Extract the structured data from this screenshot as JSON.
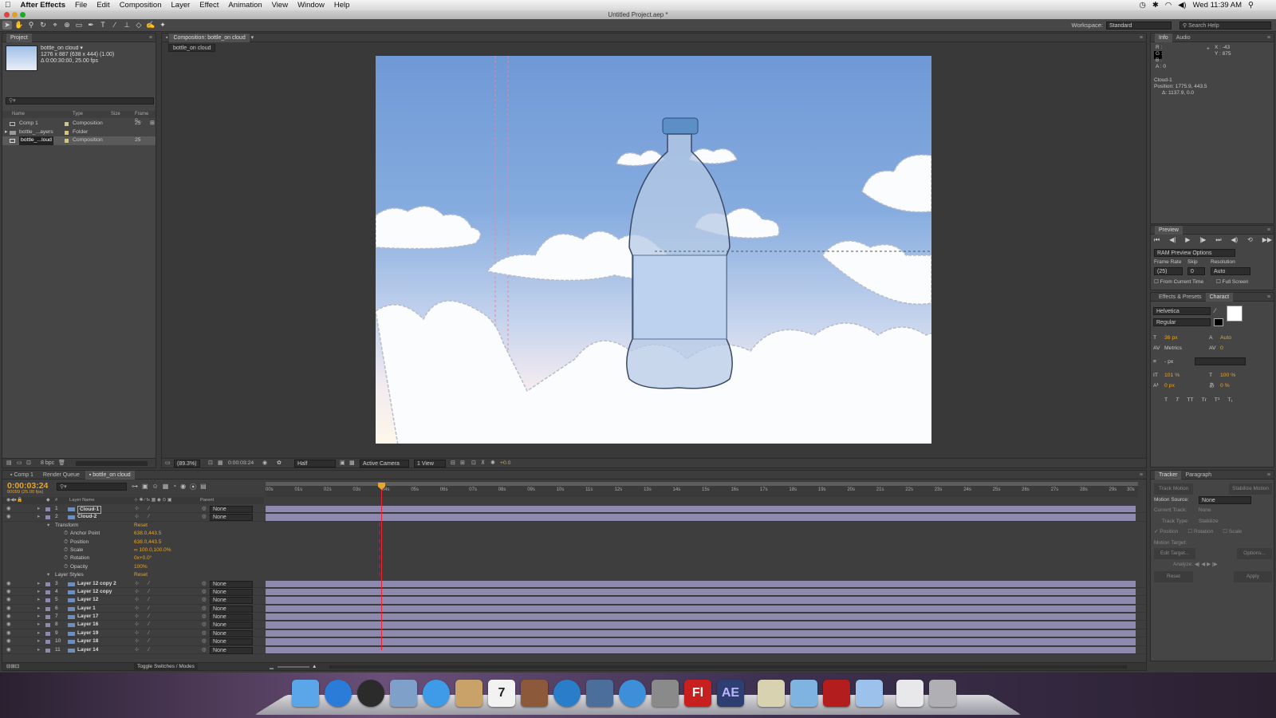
{
  "menubar": {
    "app": "After Effects",
    "items": [
      "File",
      "Edit",
      "Composition",
      "Layer",
      "Effect",
      "Animation",
      "View",
      "Window",
      "Help"
    ],
    "clock": "Wed 11:39 AM"
  },
  "window": {
    "title": "Untitled Project.aep *"
  },
  "toolbar": {
    "workspace_label": "Workspace:",
    "workspace_value": "Standard",
    "search_placeholder": "Search Help"
  },
  "project": {
    "tab": "Project",
    "item_name": "bottle_on cloud ▾",
    "item_dims": "1276 x 887  (638 x 444) (1.00)",
    "item_dur": "Δ 0:00:30:00, 25.00 fps",
    "cols": [
      "Name",
      "Type",
      "Size",
      "Frame R..."
    ],
    "rows": [
      {
        "name": "Comp 1",
        "type": "Composition",
        "fr": "25"
      },
      {
        "name": "bottle_...ayers",
        "type": "Folder",
        "fr": ""
      },
      {
        "name": "bottle_...loud",
        "type": "Composition",
        "fr": "25"
      }
    ],
    "bpc": "8 bpc"
  },
  "comp": {
    "tab": "Composition: bottle_on cloud",
    "subtab": "bottle_on cloud",
    "zoom": "(89.3%)",
    "time": "0:00:03:24",
    "res": "Half",
    "camera": "Active Camera",
    "views": "1 View",
    "exposure": "+0.0"
  },
  "info": {
    "tabs": [
      "Info",
      "Audio"
    ],
    "r": "R :",
    "g": "G :",
    "b": "B :",
    "a": "A : 0",
    "x": "X : -43",
    "y": "Y : 875",
    "layer": "Cloud-1",
    "position": "Position: 1775.9, 443.5",
    "delta": "Δ: 1137.9, 0.0"
  },
  "preview": {
    "tab": "Preview",
    "ram": "RAM Preview Options",
    "fr_label": "Frame Rate",
    "skip_label": "Skip",
    "res_label": "Resolution",
    "fr_val": "(25)",
    "skip_val": "0",
    "res_val": "Auto",
    "from_current": "From Current Time",
    "full_screen": "Full Screen"
  },
  "character": {
    "tabs": [
      "Effects & Presets",
      "Charact"
    ],
    "font": "Helvetica",
    "style": "Regular",
    "size": "36 px",
    "leading": "Auto",
    "kerning": "Metrics",
    "tracking": "0",
    "stroke": "- px",
    "vscale": "101 %",
    "hscale": "100 %",
    "baseline": "0 px",
    "tsume": "0 %",
    "buttons": [
      "T",
      "T",
      "TT",
      "Tr",
      "T¹",
      "T₁"
    ]
  },
  "tracker": {
    "tabs": [
      "Tracker",
      "Paragraph"
    ],
    "track_motion": "Track Motion",
    "stabilize": "Stabilize Motion",
    "motion_source": "Motion Source:",
    "motion_source_val": "None",
    "current_track": "Current Track:",
    "current_track_val": "None",
    "track_type": "Track Type:",
    "track_type_val": "Stabilize",
    "position": "Position",
    "rotation": "Rotation",
    "scale": "Scale",
    "motion_target": "Motion Target:",
    "edit_target": "Edit Target...",
    "options": "Options...",
    "analyze": "Analyze:",
    "reset": "Reset",
    "apply": "Apply"
  },
  "timeline": {
    "tabs": [
      "Comp 1",
      "Render Queue",
      "bottle_on cloud"
    ],
    "time": "0:00:03:24",
    "frames": "00099 (25.00 fps)",
    "col_layer": "Layer Name",
    "col_parent": "Parent",
    "toggle": "Toggle Switches / Modes",
    "ruler": [
      "00s",
      "01s",
      "02s",
      "03s",
      "04s",
      "05s",
      "06s",
      "07s",
      "08s",
      "09s",
      "10s",
      "11s",
      "12s",
      "13s",
      "14s",
      "15s",
      "16s",
      "17s",
      "18s",
      "19s",
      "20s",
      "21s",
      "22s",
      "23s",
      "24s",
      "25s",
      "26s",
      "27s",
      "28s",
      "29s",
      "30s"
    ],
    "layers_top": [
      {
        "num": "1",
        "name": "Cloud-1",
        "parent": "None"
      },
      {
        "num": "2",
        "name": "Cloud-2",
        "parent": "None"
      }
    ],
    "transform": {
      "label": "Transform",
      "reset": "Reset",
      "props": [
        {
          "name": "Anchor Point",
          "value": "638.0,443.5"
        },
        {
          "name": "Position",
          "value": "638.0,443.5"
        },
        {
          "name": "Scale",
          "value": "∞ 100.0,100.0%"
        },
        {
          "name": "Rotation",
          "value": "0x+0.0°"
        },
        {
          "name": "Opacity",
          "value": "100%"
        }
      ],
      "layer_styles": "Layer Styles",
      "ls_reset": "Reset"
    },
    "layers": [
      {
        "num": "3",
        "name": "Layer 12 copy 2",
        "parent": "None"
      },
      {
        "num": "4",
        "name": "Layer 12 copy",
        "parent": "None"
      },
      {
        "num": "5",
        "name": "Layer 12",
        "parent": "None"
      },
      {
        "num": "6",
        "name": "Layer 1",
        "parent": "None"
      },
      {
        "num": "7",
        "name": "Layer 17",
        "parent": "None"
      },
      {
        "num": "8",
        "name": "Layer 16",
        "parent": "None"
      },
      {
        "num": "9",
        "name": "Layer 19",
        "parent": "None"
      },
      {
        "num": "10",
        "name": "Layer 18",
        "parent": "None"
      },
      {
        "num": "11",
        "name": "Layer 14",
        "parent": "None"
      }
    ]
  },
  "dock": {
    "items": [
      "finder-icon",
      "app-store-icon",
      "dashboard-icon",
      "preview-icon",
      "ichat-icon",
      "mail-icon",
      "calendar-icon",
      "photo-booth-icon",
      "itunes-icon",
      "expose-icon",
      "safari-icon",
      "system-preferences-icon",
      "flash-icon",
      "after-effects-icon",
      "preview-doc-icon",
      "folder-icon",
      "pdf-icon",
      "screen-icon",
      "document-icon",
      "trash-icon"
    ],
    "fl": "Fl",
    "ae": "AE",
    "cal_day": "7"
  },
  "colors": {
    "accent": "#e8a42c",
    "panel": "#454545",
    "layer_bar": "#8e8aaf",
    "sky": "#7ea3dc"
  }
}
